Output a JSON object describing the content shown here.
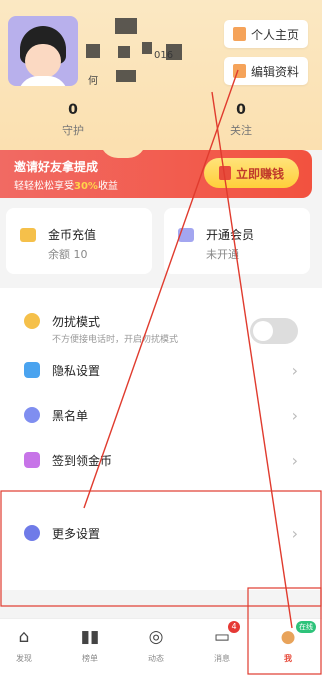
{
  "profile": {
    "name_fragment": "016",
    "second_line_fragment": "何"
  },
  "header_buttons": {
    "homepage": "个人主页",
    "edit_profile": "编辑资料"
  },
  "stats": [
    {
      "value": "0",
      "label": "守护"
    },
    {
      "value": "0",
      "label": "关注"
    }
  ],
  "invite_banner": {
    "title": "邀请好友拿提成",
    "subtitle_prefix": "轻轻松松享受",
    "subtitle_highlight": "30%",
    "subtitle_suffix": "收益",
    "cta_label": "立即赚钱"
  },
  "cards": [
    {
      "title": "金币充值",
      "subtitle": "余额 10"
    },
    {
      "title": "开通会员",
      "subtitle": "未开通"
    }
  ],
  "menu": {
    "dnd_label": "勿扰模式",
    "dnd_desc": "不方便接电话时，开启勿扰模式",
    "privacy": "隐私设置",
    "blacklist": "黑名单",
    "checkin": "签到领金币",
    "more": "更多设置"
  },
  "tabbar": [
    {
      "label": "发现"
    },
    {
      "label": "榜单"
    },
    {
      "label": "动态"
    },
    {
      "label": "消息",
      "badge": "4"
    },
    {
      "label": "我",
      "badge": "在线"
    }
  ],
  "colors": {
    "accent": "#e74c3c",
    "header_bg": "#fbe0b0",
    "banner_red": "#f2523f"
  }
}
